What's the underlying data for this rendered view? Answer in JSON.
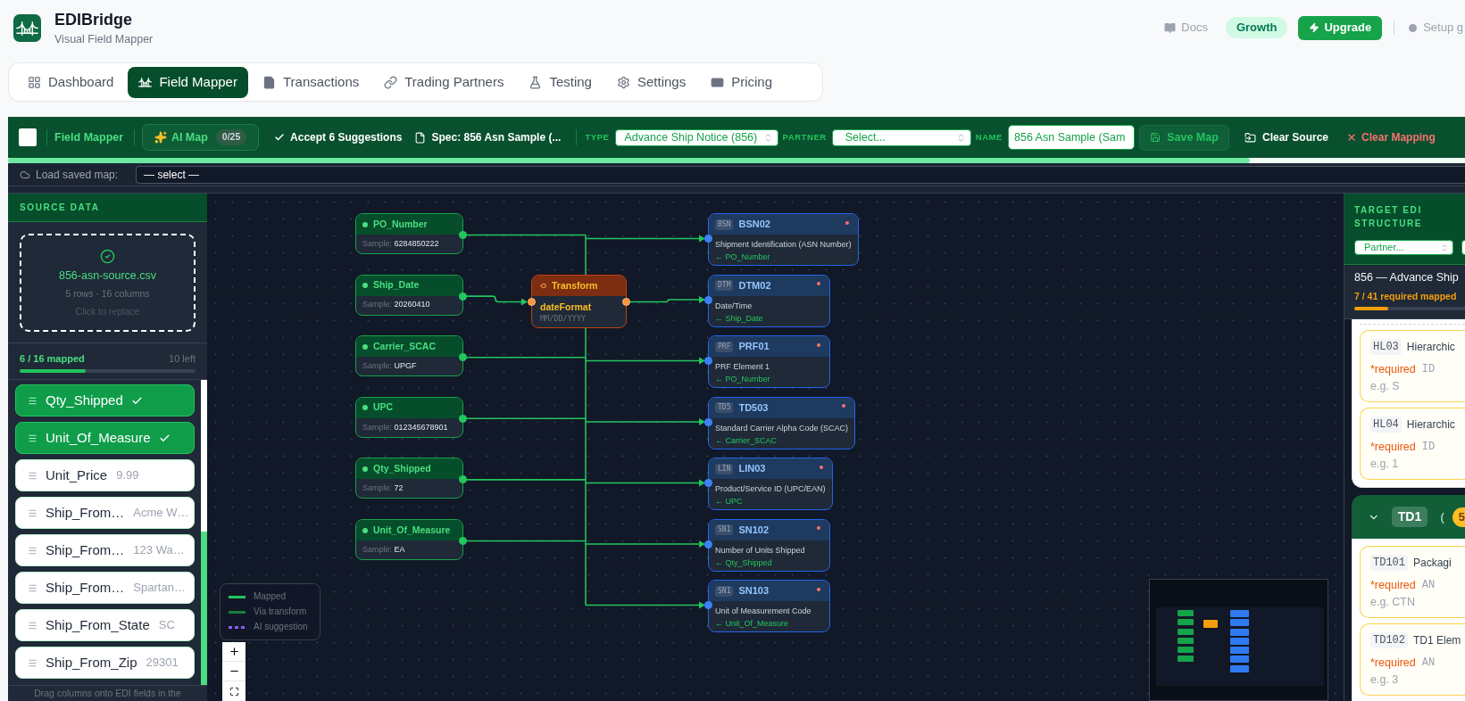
{
  "app": {
    "title": "EDIBridge",
    "subtitle": "Visual Field Mapper"
  },
  "header_actions": {
    "docs": "Docs",
    "plan": "Growth",
    "upgrade": "Upgrade",
    "setup": "Setup g"
  },
  "nav_tabs": [
    {
      "label": "Dashboard",
      "selected": false
    },
    {
      "label": "Field Mapper",
      "selected": true
    },
    {
      "label": "Transactions",
      "selected": false
    },
    {
      "label": "Trading Partners",
      "selected": false
    },
    {
      "label": "Testing",
      "selected": false
    },
    {
      "label": "Settings",
      "selected": false
    },
    {
      "label": "Pricing",
      "selected": false
    }
  ],
  "toolbar": {
    "title": "Field Mapper",
    "ai_map": {
      "label": "AI Map",
      "count": "0/25"
    },
    "accept": "Accept 6 Suggestions",
    "spec": "Spec: 856 Asn Sample (...",
    "type": {
      "label": "TYPE",
      "value": "Advance Ship Notice (856)"
    },
    "partner": {
      "label": "PARTNER",
      "placeholder": "Select..."
    },
    "name": {
      "label": "NAME",
      "value": "856 Asn Sample (Sam"
    },
    "save": "Save Map",
    "clear_source": "Clear Source",
    "clear_mapping": "Clear Mapping"
  },
  "load_map": {
    "label": "Load saved map:",
    "value": "— select —"
  },
  "source_panel": {
    "title": "SOURCE DATA",
    "file": {
      "name": "856-asn-source.csv",
      "meta": "5 rows · 16 columns",
      "hint": "Click to replace"
    },
    "progress": {
      "label": "6 / 16 mapped",
      "remaining": "10 left",
      "level": 0.375
    },
    "columns": [
      {
        "name": "Qty_Shipped",
        "mapped": true
      },
      {
        "name": "Unit_Of_Measure",
        "mapped": true
      },
      {
        "name": "Unit_Price",
        "sample": "9.99",
        "mapped": false
      },
      {
        "name": "Ship_From…",
        "sample": "Acme W…",
        "mapped": false
      },
      {
        "name": "Ship_From…",
        "sample": "123 Wa…",
        "mapped": false
      },
      {
        "name": "Ship_From…",
        "sample": "Spartan…",
        "mapped": false
      },
      {
        "name": "Ship_From_State",
        "sample": "SC",
        "mapped": false
      },
      {
        "name": "Ship_From_Zip",
        "sample": "29301",
        "mapped": false
      }
    ],
    "footer": "Drag columns onto EDI fields in the"
  },
  "canvas": {
    "source_nodes": [
      {
        "label": "PO_Number",
        "sample_label": "Sample:",
        "sample": "6284850222",
        "kind": "bus"
      },
      {
        "label": "Ship_Date",
        "sample_label": "Sample:",
        "sample": "20260410",
        "kind": "transform"
      },
      {
        "label": "Carrier_SCAC",
        "sample_label": "Sample:",
        "sample": "UPGF",
        "kind": "bus"
      },
      {
        "label": "UPC",
        "sample_label": "Sample:",
        "sample": "012345678901",
        "kind": "bus"
      },
      {
        "label": "Qty_Shipped",
        "sample_label": "Sample:",
        "sample": "72",
        "kind": "bus"
      },
      {
        "label": "Unit_Of_Measure",
        "sample_label": "Sample:",
        "sample": "EA",
        "kind": "bus"
      }
    ],
    "transform": {
      "title": "Transform",
      "function": "dateFormat",
      "format": "MM/DD/YYYY"
    },
    "target_nodes": [
      {
        "segment": "BSN",
        "code": "BSN02",
        "required": true,
        "description": "Shipment Identification (ASN Number)",
        "source": "← PO_Number",
        "kind": "bus"
      },
      {
        "segment": "DTM",
        "code": "DTM02",
        "required": true,
        "description": "Date/Time",
        "source": "← Ship_Date",
        "kind": "transform"
      },
      {
        "segment": "PRF",
        "code": "PRF01",
        "required": true,
        "description": "PRF Element 1",
        "source": "← PO_Number",
        "kind": "bus"
      },
      {
        "segment": "TD5",
        "code": "TD503",
        "required": true,
        "description": "Standard Carrier Alpha Code (SCAC)",
        "source": "← Carrier_SCAC",
        "kind": "bus"
      },
      {
        "segment": "LIN",
        "code": "LIN03",
        "required": true,
        "description": "Product/Service ID (UPC/EAN)",
        "source": "← UPC",
        "kind": "bus"
      },
      {
        "segment": "SN1",
        "code": "SN102",
        "required": true,
        "description": "Number of Units Shipped",
        "source": "← Qty_Shipped",
        "kind": "bus"
      },
      {
        "segment": "SN1",
        "code": "SN103",
        "required": true,
        "description": "Unit of Measurement Code",
        "source": "← Unit_Of_Measure",
        "kind": "bus"
      }
    ],
    "legend": [
      {
        "kind": "mapped",
        "label": "Mapped"
      },
      {
        "kind": "transform",
        "label": "Via transform"
      },
      {
        "kind": "ai",
        "label": "AI suggestion"
      }
    ]
  },
  "target_panel": {
    "title": "TARGET EDI STRUCTURE",
    "partner_placeholder": "Partner...",
    "transaction": "856 — Advance Ship",
    "progress": {
      "label": "7 / 41 required mapped",
      "level": 0.31
    },
    "segments": [
      {
        "elements": [
          {
            "code": "HL03",
            "name": "Hierarchic",
            "required_label": "*required",
            "type": "ID",
            "example": "e.g. S"
          },
          {
            "code": "HL04",
            "name": "Hierarchic",
            "required_label": "*required",
            "type": "ID",
            "example": "e.g. 1"
          }
        ]
      },
      {
        "code": "TD1",
        "expanded": true,
        "title": "(",
        "count": "5",
        "elements": [
          {
            "code": "TD101",
            "name": "Packagi",
            "required_label": "*required",
            "type": "AN",
            "example": "e.g. CTN"
          },
          {
            "code": "TD102",
            "name": "TD1 Elem",
            "required_label": "*required",
            "type": "AN",
            "example": "e.g. 3"
          }
        ]
      }
    ]
  }
}
